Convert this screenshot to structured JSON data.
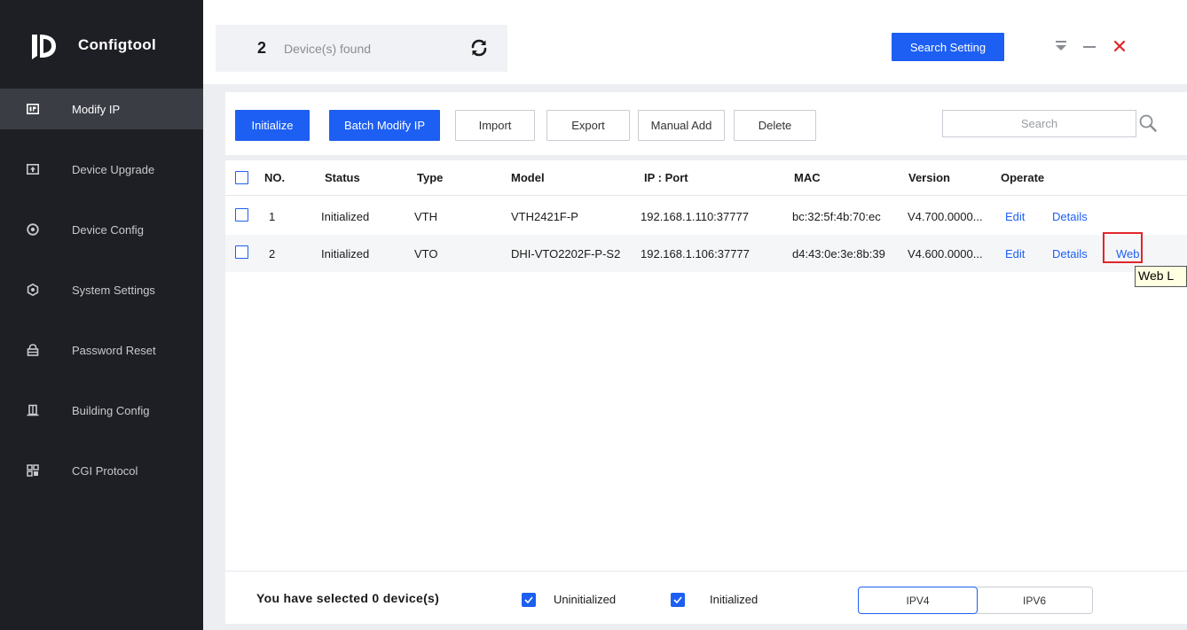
{
  "app": {
    "name": "Configtool"
  },
  "sidebar": {
    "items": [
      {
        "label": "Modify IP",
        "icon": "ip-icon",
        "active": true
      },
      {
        "label": "Device Upgrade",
        "icon": "upgrade-icon",
        "active": false
      },
      {
        "label": "Device Config",
        "icon": "config-icon",
        "active": false
      },
      {
        "label": "System Settings",
        "icon": "settings-icon",
        "active": false
      },
      {
        "label": "Password Reset",
        "icon": "lock-icon",
        "active": false
      },
      {
        "label": "Building Config",
        "icon": "building-icon",
        "active": false
      },
      {
        "label": "CGI Protocol",
        "icon": "protocol-icon",
        "active": false
      }
    ]
  },
  "header": {
    "device_count": "2",
    "device_count_label": "Device(s) found",
    "search_setting_label": "Search Setting"
  },
  "toolbar": {
    "initialize_label": "Initialize",
    "batch_modify_label": "Batch Modify IP",
    "import_label": "Import",
    "export_label": "Export",
    "manual_add_label": "Manual Add",
    "delete_label": "Delete",
    "search_placeholder": "Search"
  },
  "table": {
    "columns": [
      "NO.",
      "Status",
      "Type",
      "Model",
      "IP : Port",
      "MAC",
      "Version",
      "Operate"
    ],
    "rows": [
      {
        "no": "1",
        "status": "Initialized",
        "type": "VTH",
        "model": "VTH2421F-P",
        "ip_port": "192.168.1.110:37777",
        "mac": "bc:32:5f:4b:70:ec",
        "version": "V4.700.0000...",
        "edit": "Edit",
        "details": "Details",
        "web": ""
      },
      {
        "no": "2",
        "status": "Initialized",
        "type": "VTO",
        "model": "DHI-VTO2202F-P-S2",
        "ip_port": "192.168.1.106:37777",
        "mac": "d4:43:0e:3e:8b:39",
        "version": "V4.600.0000...",
        "edit": "Edit",
        "details": "Details",
        "web": "Web"
      }
    ]
  },
  "tooltip": {
    "text": "Web L"
  },
  "footer": {
    "selected_text": "You have selected 0  device(s)",
    "uninitialized_label": "Uninitialized",
    "initialized_label": "Initialized",
    "ipv4_label": "IPV4",
    "ipv6_label": "IPV6"
  },
  "colors": {
    "accent": "#1d5ff2",
    "sidebar_bg": "#1e1f24",
    "highlight": "#e0252b"
  }
}
